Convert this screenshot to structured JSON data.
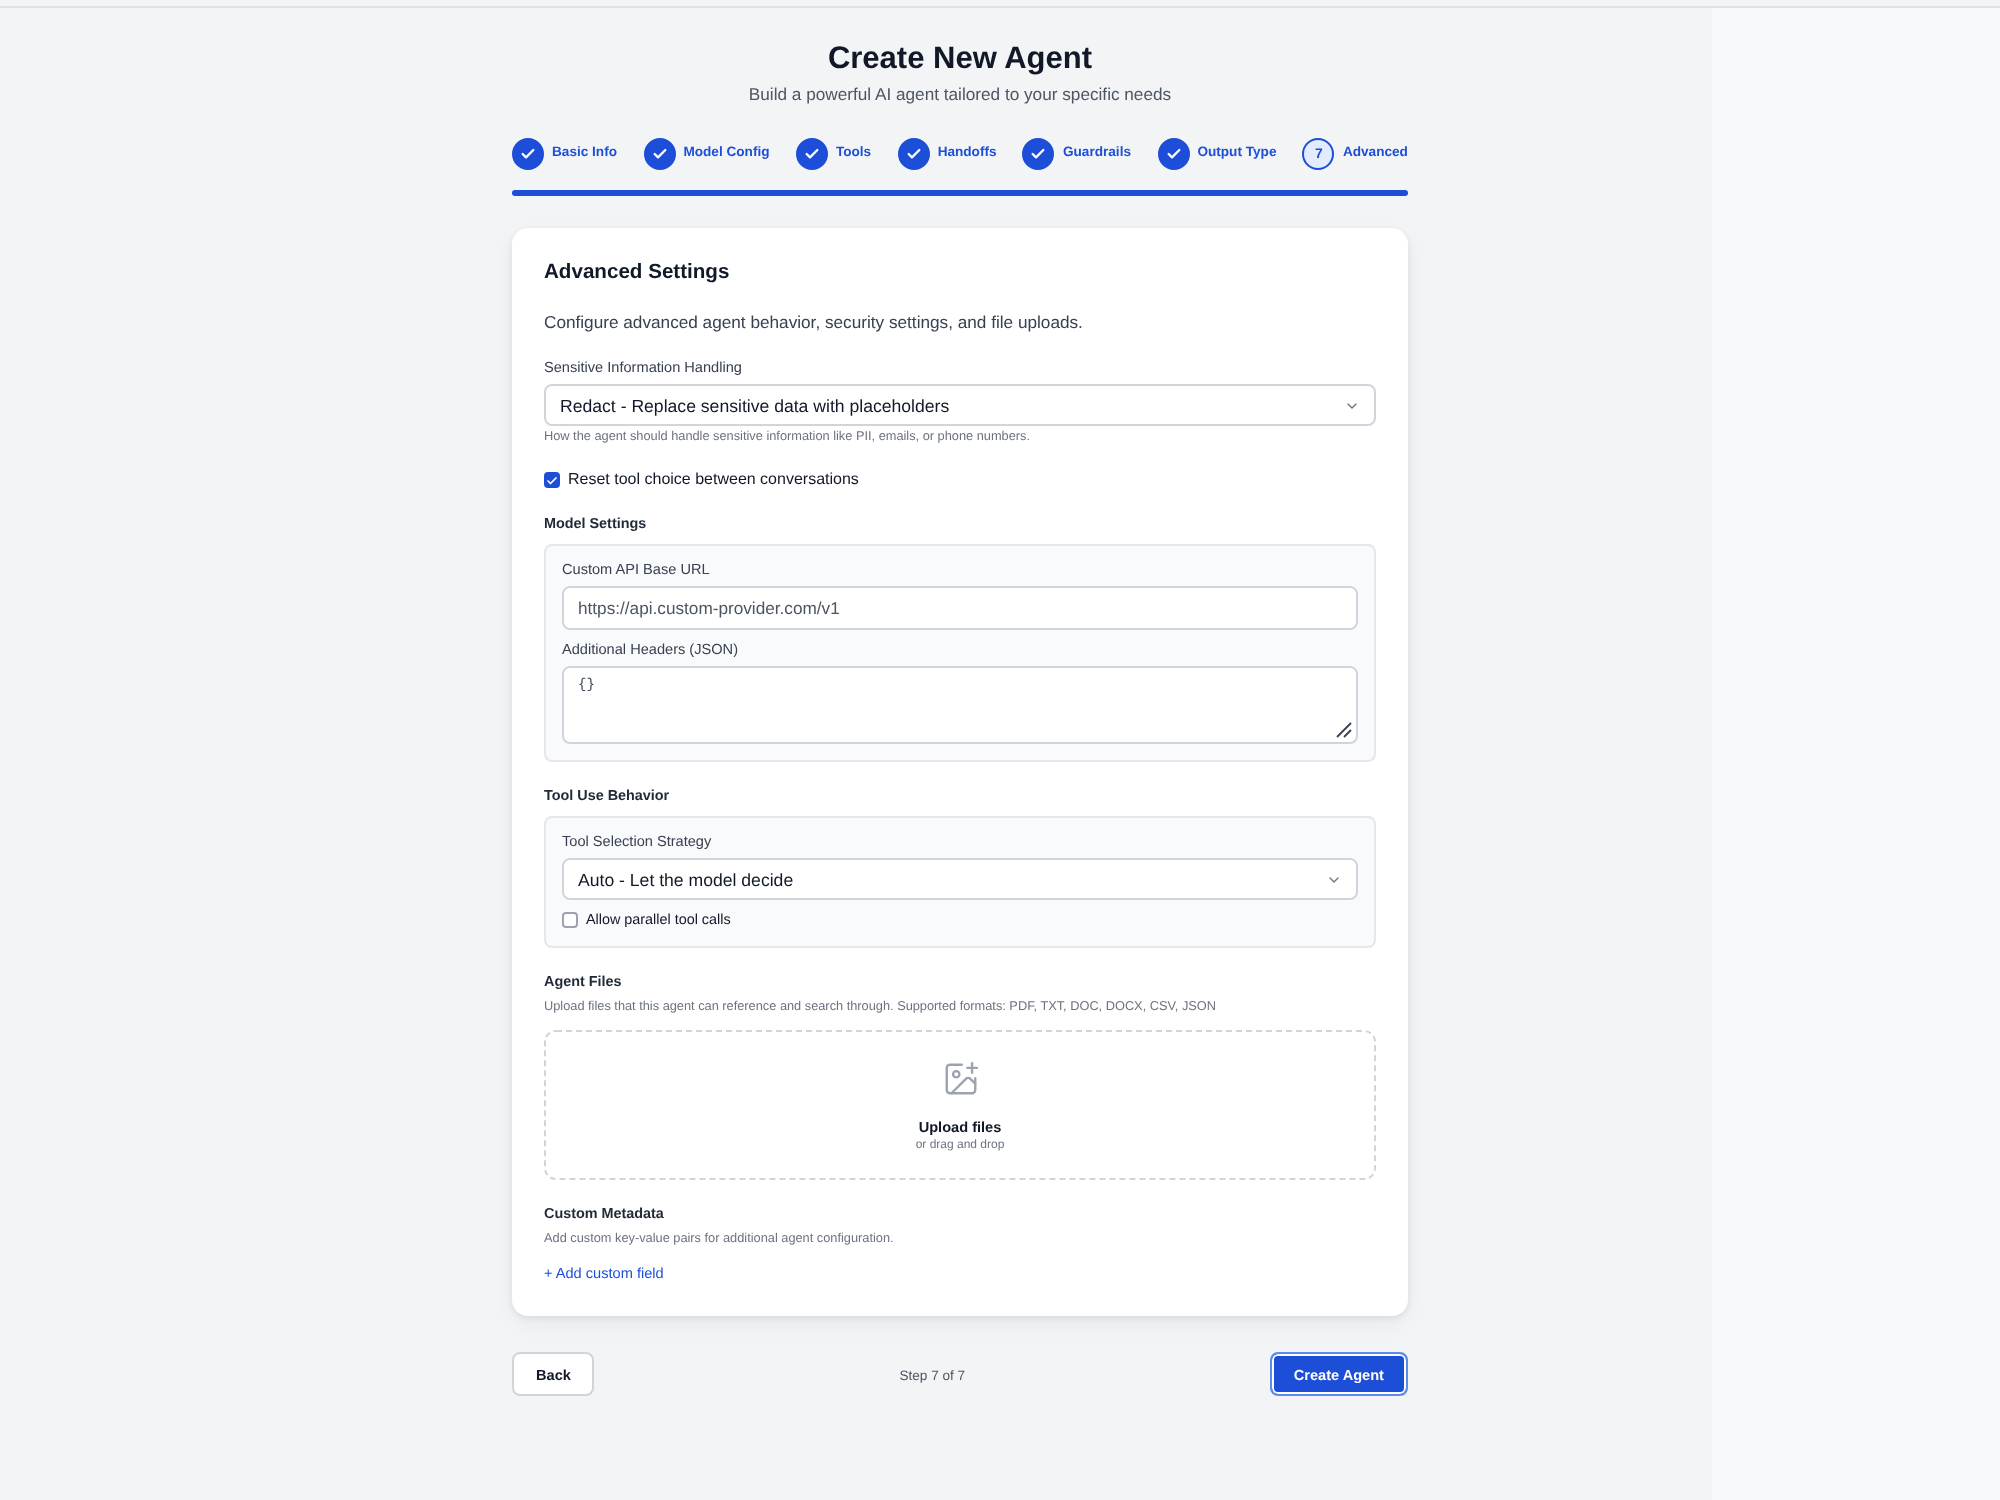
{
  "header": {
    "title": "Create New Agent",
    "subtitle": "Build a powerful AI agent tailored to your specific needs"
  },
  "steps": [
    {
      "label": "Basic Info",
      "completed": true
    },
    {
      "label": "Model Config",
      "completed": true
    },
    {
      "label": "Tools",
      "completed": true
    },
    {
      "label": "Handoffs",
      "completed": true
    },
    {
      "label": "Guardrails",
      "completed": true
    },
    {
      "label": "Output Type",
      "completed": true
    },
    {
      "label": "Advanced",
      "number": "7",
      "completed": false
    }
  ],
  "progress": {
    "level": 1
  },
  "card": {
    "title": "Advanced Settings",
    "description": "Configure advanced agent behavior, security settings, and file uploads.",
    "sensitive_info": {
      "label": "Sensitive Information Handling",
      "value": "Redact - Replace sensitive data with placeholders",
      "hint": "How the agent should handle sensitive information like PII, emails, or phone numbers."
    },
    "reset_tool_choice": {
      "label": "Reset tool choice between conversations",
      "checked": true
    },
    "model_settings": {
      "title": "Model Settings",
      "base_url": {
        "label": "Custom API Base URL",
        "value": "https://api.custom-provider.com/v1"
      },
      "headers": {
        "label": "Additional Headers (JSON)",
        "value": "{}"
      }
    },
    "tool_use": {
      "title": "Tool Use Behavior",
      "strategy": {
        "label": "Tool Selection Strategy",
        "value": "Auto - Let the model decide"
      },
      "parallel_calls": {
        "label": "Allow parallel tool calls",
        "checked": false
      }
    },
    "agent_files": {
      "title": "Agent Files",
      "description": "Upload files that this agent can reference and search through. Supported formats: PDF, TXT, DOC, DOCX, CSV, JSON",
      "dropzone": {
        "title": "Upload files",
        "hint": "or drag and drop"
      }
    },
    "custom_metadata": {
      "title": "Custom Metadata",
      "description": "Add custom key-value pairs for additional agent configuration.",
      "link": "+ Add custom field"
    }
  },
  "footer": {
    "back": "Back",
    "step_text": "Step 7 of 7",
    "submit": "Create Agent"
  }
}
